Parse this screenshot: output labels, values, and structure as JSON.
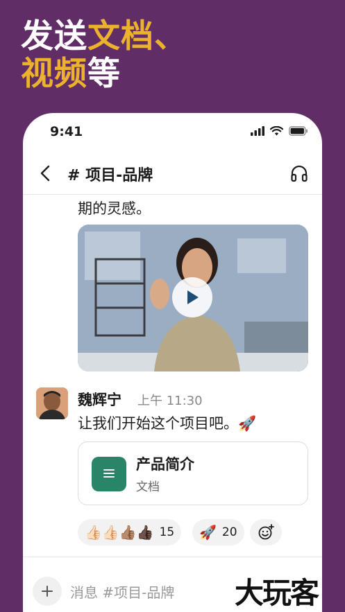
{
  "headline": {
    "line1_a": "发送",
    "line1_b": "文档、",
    "line2_a": "视频",
    "line2_b": "等"
  },
  "colors": {
    "background": "#612D67",
    "highlight": "#ECB22E",
    "doc_icon": "#2A8468"
  },
  "status_bar": {
    "time": "9:41",
    "icons": [
      "signal-icon",
      "wifi-icon",
      "battery-icon"
    ]
  },
  "channel": {
    "back_icon": "chevron-left-icon",
    "title": "# 项目-品牌",
    "headphones_icon": "headphones-icon"
  },
  "messages": {
    "partial_text": "期的灵感。",
    "video": {
      "play_icon": "play-icon"
    },
    "author": "魏辉宁",
    "timestamp": "上午 11:30",
    "text": "让我们开始这个项目吧。🚀",
    "attachment": {
      "name": "产品简介",
      "type": "文档",
      "icon": "document-icon"
    }
  },
  "reactions": [
    {
      "emojis": "👍🏻👍🏻👍🏽👍🏿",
      "count": "15"
    },
    {
      "emojis": "🚀",
      "count": "20"
    }
  ],
  "add_reaction_icon": "add-emoji-icon",
  "composer": {
    "placeholder": "消息 #项目-品牌",
    "plus_icon": "plus-icon"
  },
  "watermark": "大玩客"
}
